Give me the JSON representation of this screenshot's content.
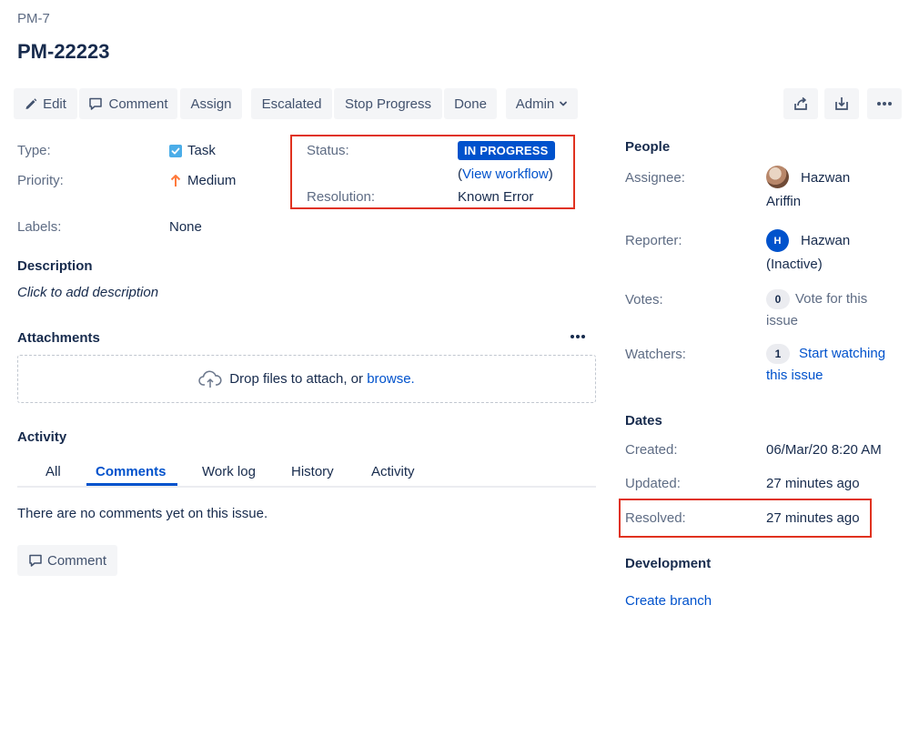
{
  "breadcrumb": {
    "parent": "PM-7"
  },
  "issue": {
    "key": "PM-22223"
  },
  "toolbar": {
    "edit": "Edit",
    "comment": "Comment",
    "assign": "Assign",
    "escalated": "Escalated",
    "stop_progress": "Stop Progress",
    "done": "Done",
    "admin": "Admin"
  },
  "details": {
    "type_label": "Type:",
    "type_value": "Task",
    "priority_label": "Priority:",
    "priority_value": "Medium",
    "labels_label": "Labels:",
    "labels_value": "None",
    "status_label": "Status:",
    "status_value": "IN PROGRESS",
    "workflow_open": "(",
    "workflow_link": "View workflow",
    "workflow_close": ")",
    "resolution_label": "Resolution:",
    "resolution_value": "Known Error"
  },
  "description": {
    "title": "Description",
    "placeholder": "Click to add description"
  },
  "attachments": {
    "title": "Attachments",
    "drop_text": "Drop files to attach, or ",
    "browse": "browse."
  },
  "activity": {
    "title": "Activity",
    "tabs": [
      "All",
      "Comments",
      "Work log",
      "History",
      "Activity"
    ],
    "active_tab": "Comments",
    "empty": "There are no comments yet on this issue.",
    "comment_button": "Comment"
  },
  "people": {
    "title": "People",
    "assignee_label": "Assignee:",
    "assignee_first": "Hazwan",
    "assignee_second": "Ariffin",
    "reporter_label": "Reporter:",
    "reporter_initial": "H",
    "reporter_first": "Hazwan",
    "reporter_second": "(Inactive)",
    "votes_label": "Votes:",
    "votes_count": "0",
    "votes_text_1": "Vote for this",
    "votes_text_2": "issue",
    "watchers_label": "Watchers:",
    "watchers_count": "1",
    "watch_link_1": "Start watching",
    "watch_link_2": "this issue"
  },
  "dates": {
    "title": "Dates",
    "created_label": "Created:",
    "created_value": "06/Mar/20 8:20 AM",
    "updated_label": "Updated:",
    "updated_value": "27 minutes ago",
    "resolved_label": "Resolved:",
    "resolved_value": "27 minutes ago"
  },
  "development": {
    "title": "Development",
    "create_branch": "Create branch"
  },
  "colors": {
    "accent": "#0052cc",
    "highlight": "#e0321f",
    "priority": "#ff7a3c",
    "task": "#4bade8"
  },
  "icons": [
    "pencil-icon",
    "comment-icon",
    "chevron-down-icon",
    "share-icon",
    "export-icon",
    "more-icon",
    "task-icon",
    "priority-up-icon",
    "upload-cloud-icon"
  ]
}
